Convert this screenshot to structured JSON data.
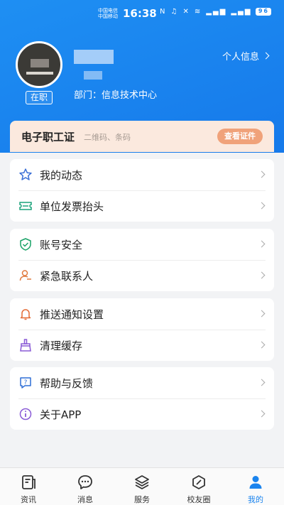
{
  "status_bar": {
    "carrier_1": "中国电信",
    "carrier_2": "中国移动",
    "time": "16:38",
    "battery": "96"
  },
  "profile": {
    "status_tag": "在职",
    "department": "部门：信息技术中心",
    "profile_link": "个人信息"
  },
  "ecard": {
    "title": "电子职工证",
    "subtitle": "二维码、条码",
    "button": "查看证件"
  },
  "menu_groups": [
    {
      "items": [
        {
          "label": "我的动态",
          "icon": "star-icon"
        },
        {
          "label": "单位发票抬头",
          "icon": "ticket-icon"
        }
      ]
    },
    {
      "items": [
        {
          "label": "账号安全",
          "icon": "shield-check-icon"
        },
        {
          "label": "紧急联系人",
          "icon": "contact-person-icon"
        }
      ]
    },
    {
      "items": [
        {
          "label": "推送通知设置",
          "icon": "bell-icon"
        },
        {
          "label": "清理缓存",
          "icon": "broom-icon"
        }
      ]
    },
    {
      "items": [
        {
          "label": "帮助与反馈",
          "icon": "help-chat-icon"
        },
        {
          "label": "关于APP",
          "icon": "info-icon"
        }
      ]
    }
  ],
  "bottom_nav": [
    {
      "label": "资讯",
      "icon": "news-icon"
    },
    {
      "label": "消息",
      "icon": "message-icon"
    },
    {
      "label": "服务",
      "icon": "layers-icon"
    },
    {
      "label": "校友圈",
      "icon": "circle-icon"
    },
    {
      "label": "我的",
      "icon": "person-icon",
      "active": true
    }
  ],
  "colors": {
    "primary": "#1b84ee",
    "ecard_bg": "#fbe9de",
    "ecard_button": "#f0a27a",
    "page_bg": "#f2f3f5"
  }
}
